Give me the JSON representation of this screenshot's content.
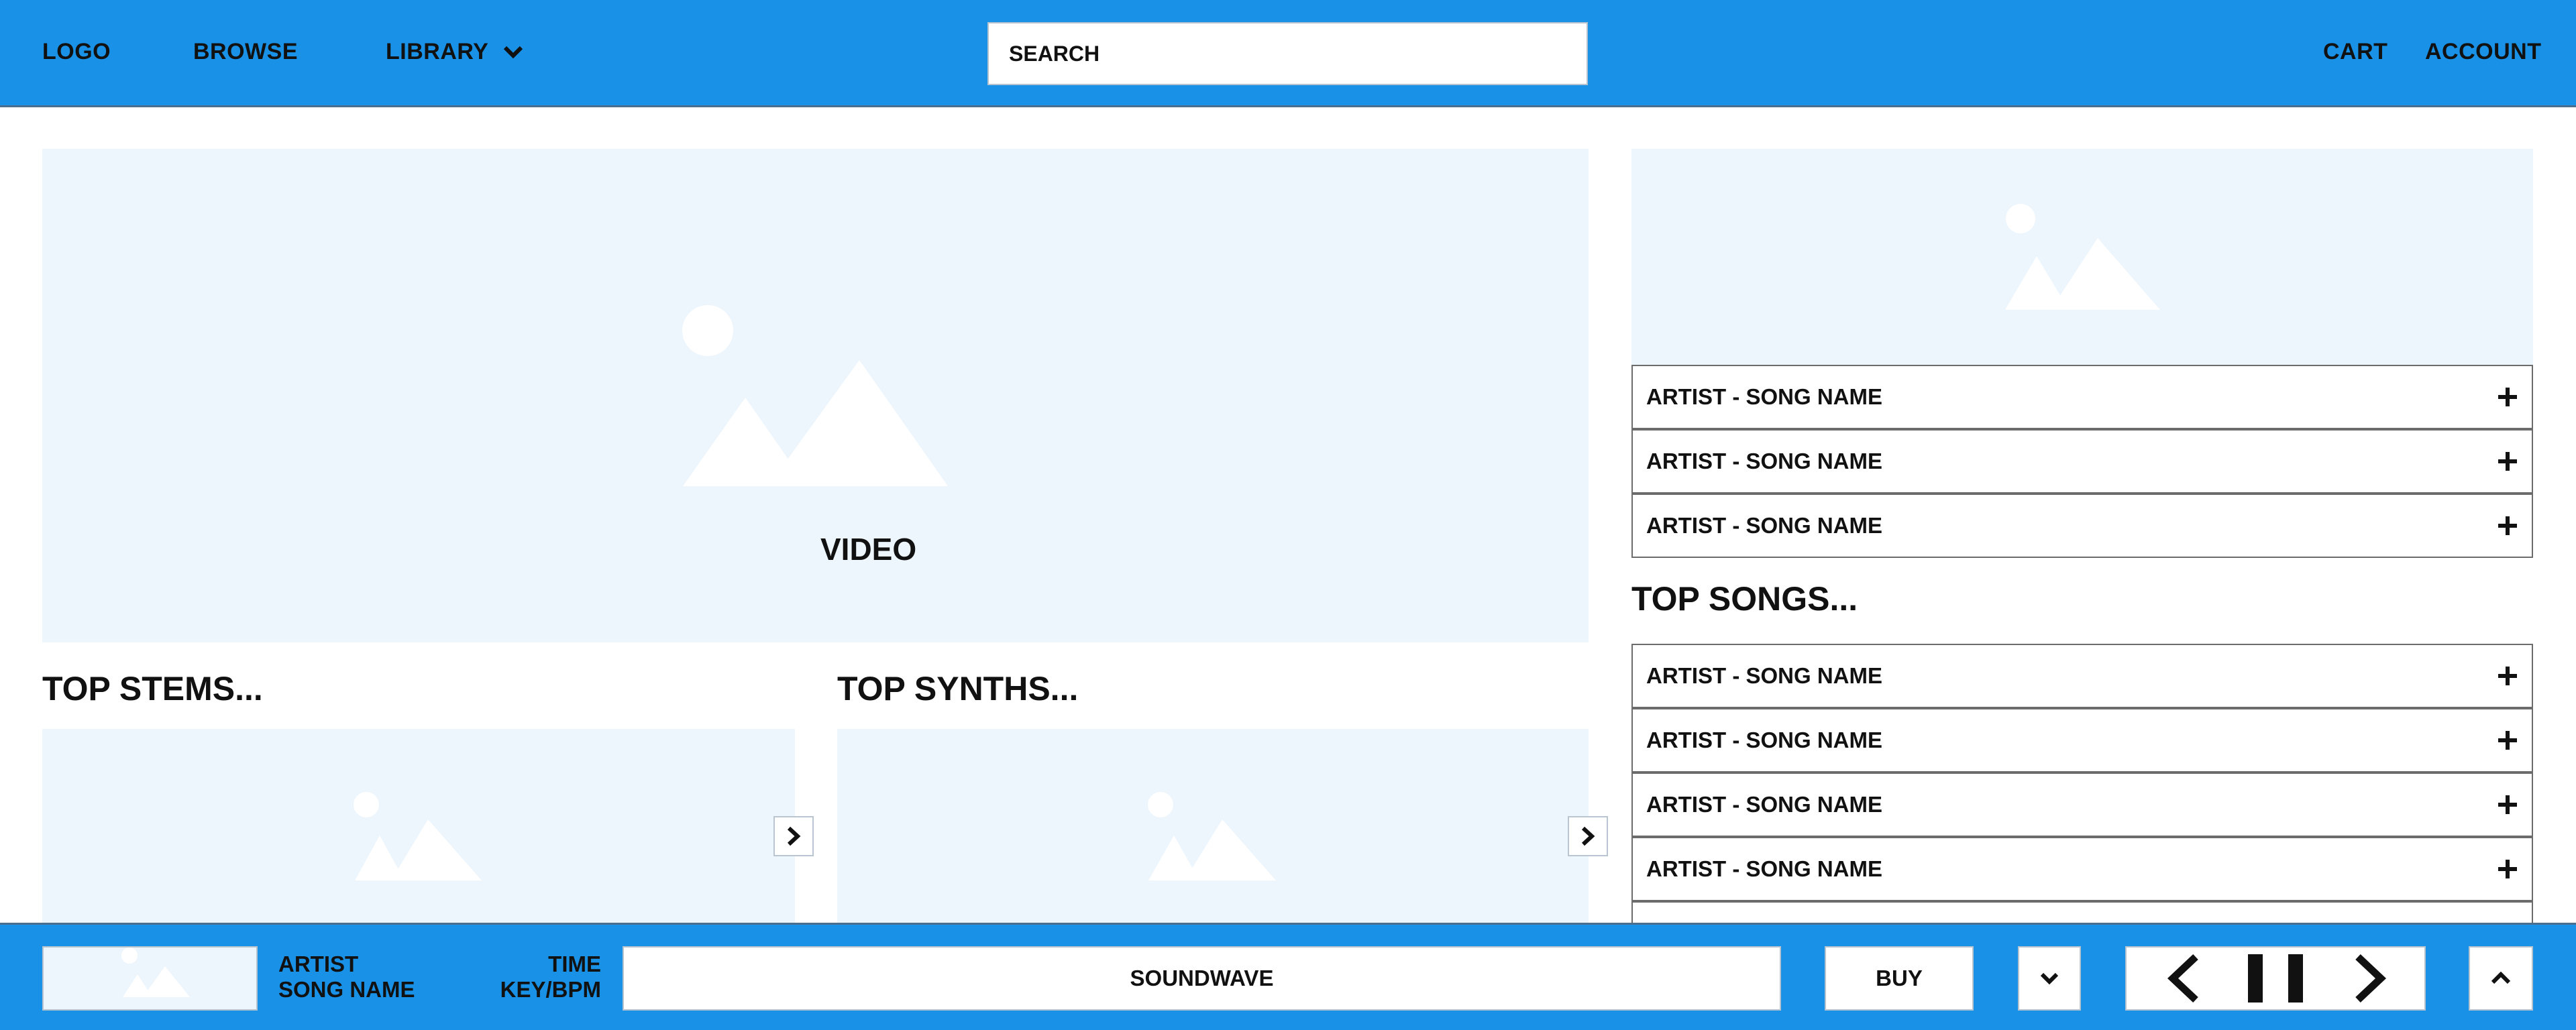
{
  "header": {
    "logo": "LOGO",
    "browse": "BROWSE",
    "library": "LIBRARY",
    "search_placeholder": "SEARCH",
    "cart": "CART",
    "account": "ACCOUNT"
  },
  "main": {
    "video_label": "VIDEO",
    "top_stems_heading": "TOP STEMS...",
    "top_synths_heading": "TOP SYNTHS...",
    "top_songs_heading": "TOP SONGS..."
  },
  "featured_songs": [
    {
      "label": "ARTIST - SONG NAME"
    },
    {
      "label": "ARTIST - SONG NAME"
    },
    {
      "label": "ARTIST - SONG NAME"
    }
  ],
  "top_songs": [
    {
      "label": "ARTIST - SONG NAME"
    },
    {
      "label": "ARTIST - SONG NAME"
    },
    {
      "label": "ARTIST - SONG NAME"
    },
    {
      "label": "ARTIST - SONG NAME"
    }
  ],
  "player": {
    "artist": "ARTIST",
    "song_name": "SONG NAME",
    "time": "TIME",
    "key_bpm": "KEY/BPM",
    "waveform_label": "SOUNDWAVE",
    "buy_label": "BUY"
  },
  "icons": {
    "library_dropdown": "chevron-down-icon",
    "add": "plus-icon",
    "carousel_next": "chevron-right-icon",
    "previous": "previous-icon",
    "pause": "pause-icon",
    "next": "next-icon",
    "collapse": "chevron-down-icon",
    "expand": "chevron-up-icon",
    "image_placeholder": "image-placeholder-icon"
  },
  "colors": {
    "bar_background": "#1891e6",
    "placeholder_fill": "#eef6fd"
  }
}
